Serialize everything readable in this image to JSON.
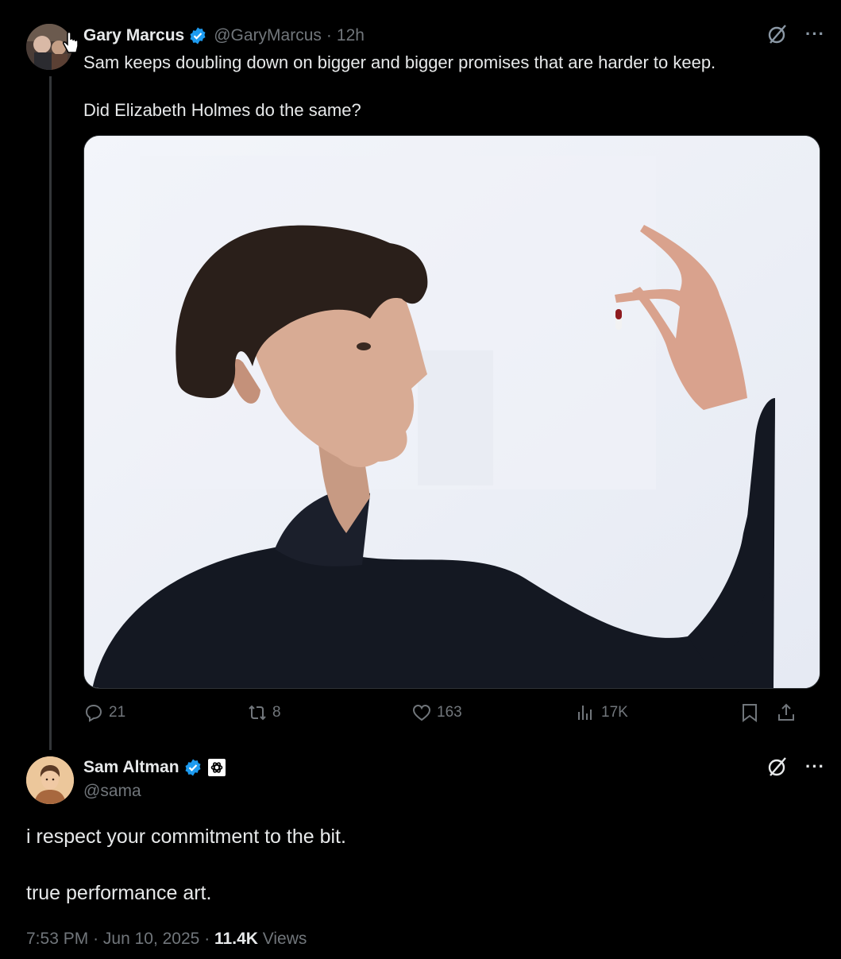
{
  "post": {
    "author_name": "Gary Marcus",
    "handle": "@GaryMarcus",
    "separator": "·",
    "time": "12h",
    "text_line1": "Sam keeps doubling down on bigger and bigger promises that are harder to keep.",
    "text_line2": "Did Elizabeth Holmes do the same?",
    "actions": {
      "replies": "21",
      "reposts": "8",
      "likes": "163",
      "views": "17K"
    }
  },
  "reply": {
    "author_name": "Sam Altman",
    "handle": "@sama",
    "text_line1": "i respect your commitment to the bit.",
    "text_line2": "true performance art.",
    "time": "7:53 PM",
    "date": "Jun 10, 2025",
    "separator": "·",
    "views_count": "11.4K",
    "views_label": "Views"
  },
  "icons": [
    "verified-badge-icon",
    "grok-icon",
    "more-icon",
    "reply-icon",
    "repost-icon",
    "like-icon",
    "views-icon",
    "bookmark-icon",
    "share-icon",
    "openai-affiliation-icon"
  ],
  "colors": {
    "background": "#000000",
    "text": "#e7e9ea",
    "muted": "#71767b",
    "verified": "#1d9bf0"
  }
}
